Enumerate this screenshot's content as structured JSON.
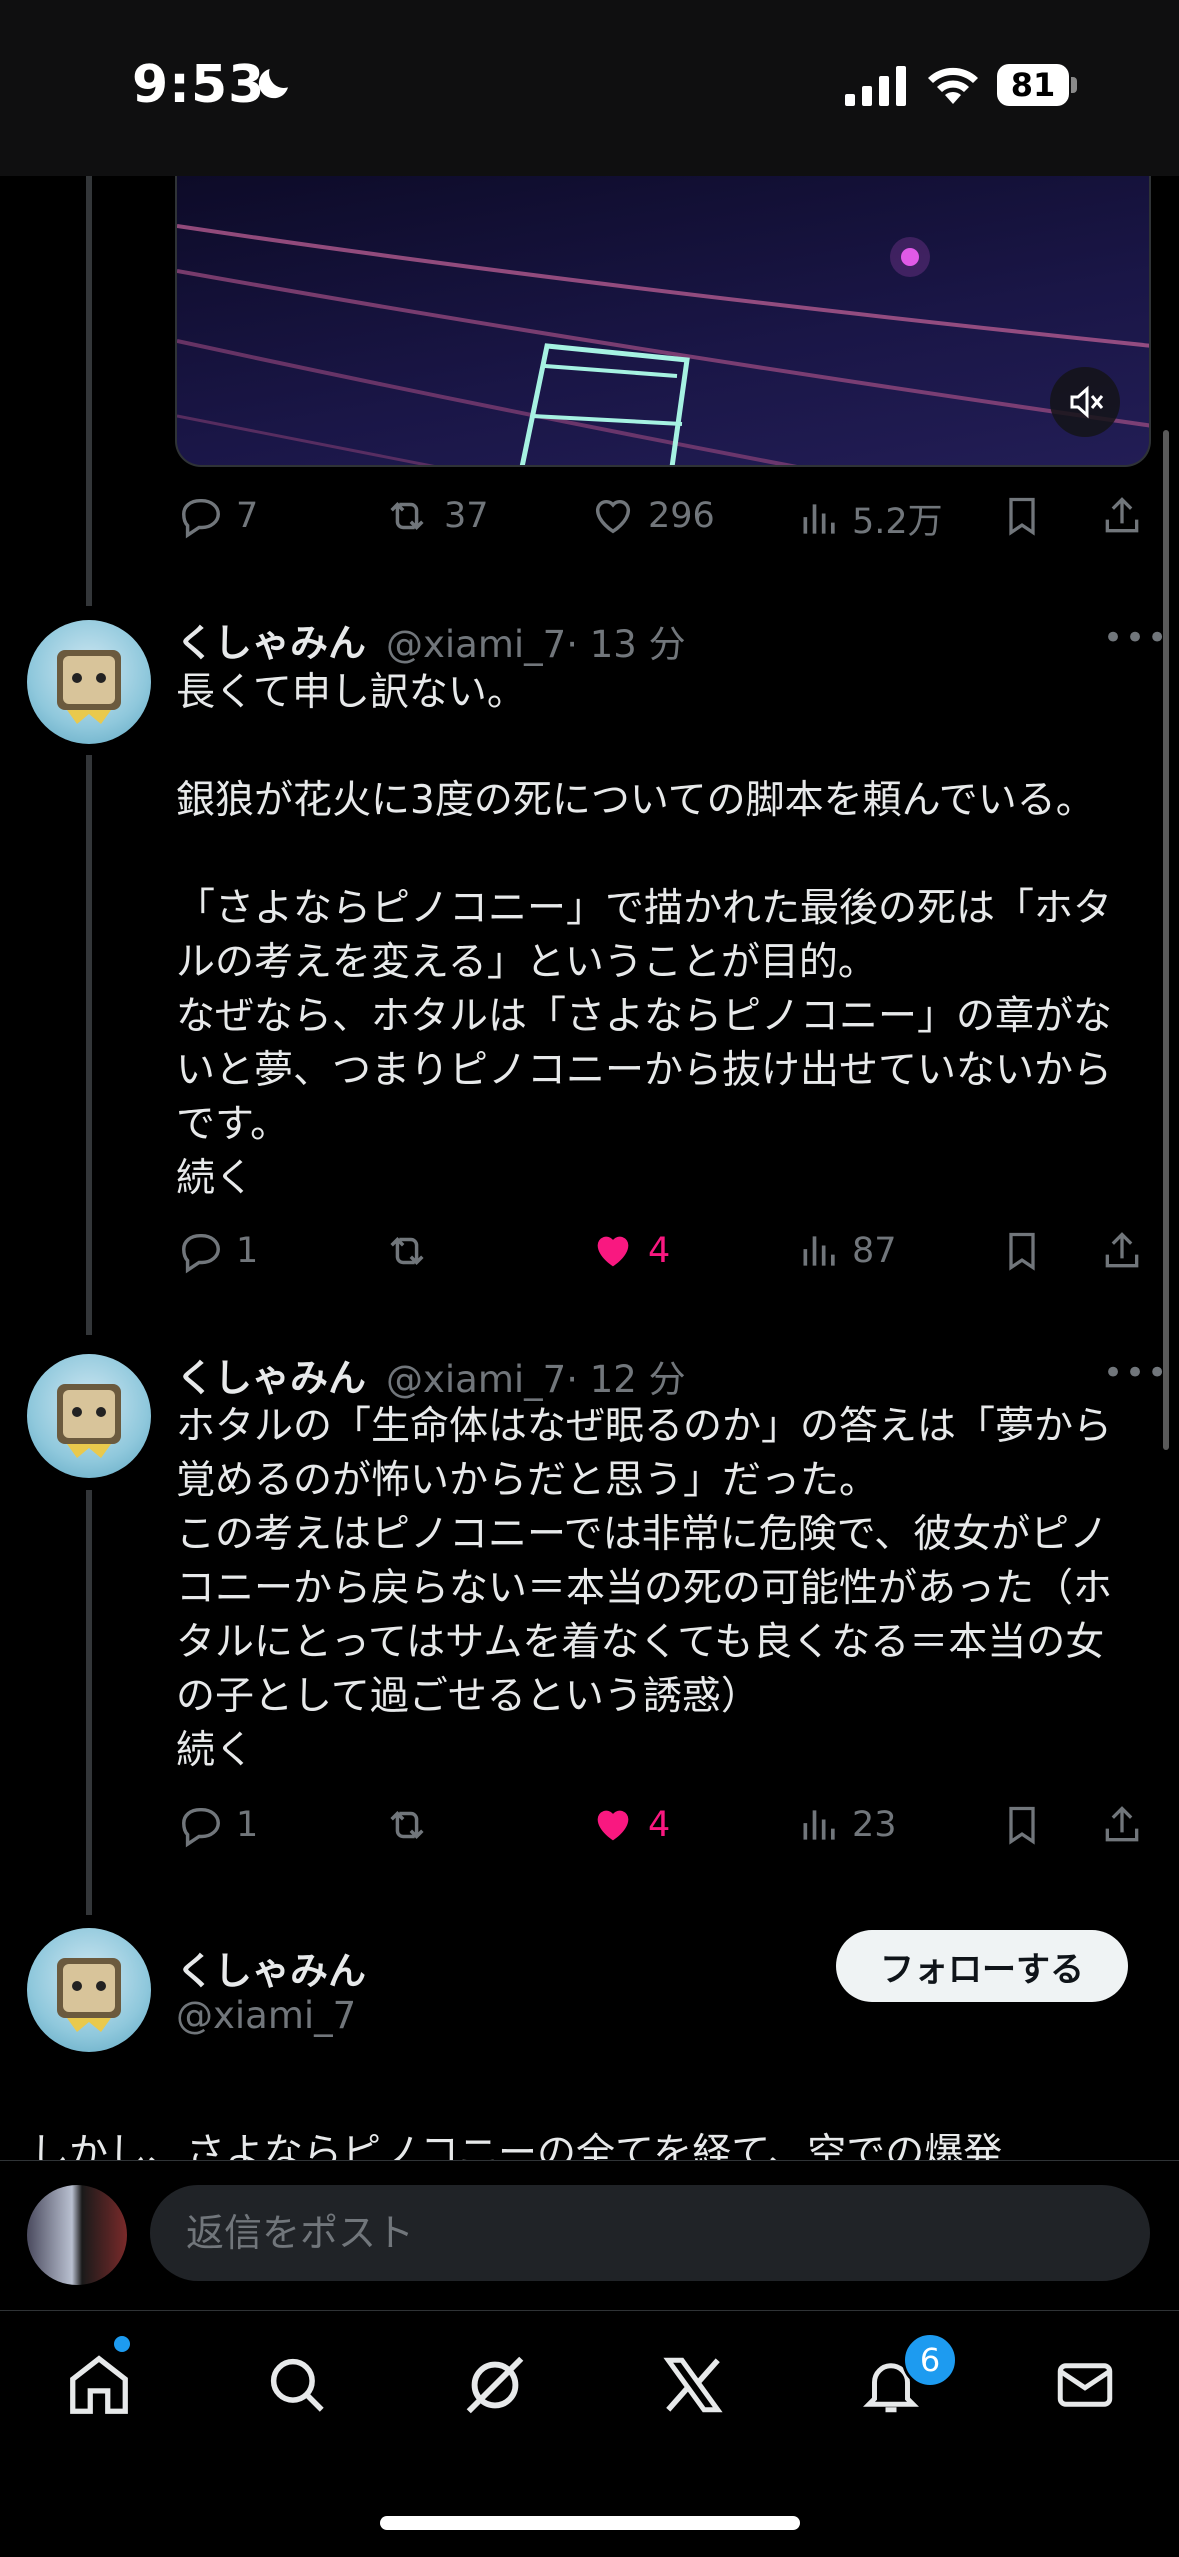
{
  "status_bar": {
    "time": "9:53",
    "battery": "81"
  },
  "posts": [
    {
      "actions": {
        "replies": "7",
        "reposts": "37",
        "likes": "296",
        "views": "5.2万"
      }
    },
    {
      "name": "くしゃみん",
      "handle": "@xiami_7",
      "time": "· 13 分",
      "text": "長くて申し訳ない。\n\n銀狼が花火に3度の死についての脚本を頼んでいる。\n\n「さよならピノコニー」で描かれた最後の死は「ホタルの考えを変える」ということが目的。\nなぜなら、ホタルは「さよならピノコニー」の章がないと夢、つまりピノコニーから抜け出せていないからです。\n続く",
      "actions": {
        "replies": "1",
        "reposts": "",
        "likes": "4",
        "views": "87"
      }
    },
    {
      "name": "くしゃみん",
      "handle": "@xiami_7",
      "time": "· 12 分",
      "text": "ホタルの「生命体はなぜ眠るのか」の答えは「夢から覚めるのが怖いからだと思う」だった。\nこの考えはピノコニーでは非常に危険で、彼女がピノコニーから戻らない＝本当の死の可能性があった（ホタルにとってはサムを着なくても良くなる＝本当の女の子として過ごせるという誘惑）\n続く",
      "actions": {
        "replies": "1",
        "reposts": "",
        "likes": "4",
        "views": "23"
      }
    },
    {
      "name": "くしゃみん",
      "handle": "@xiami_7",
      "follow_label": "フォローする",
      "text": "しかし、さよならピノコニーの全てを経て、空での爆発"
    }
  ],
  "reply_bar": {
    "placeholder": "返信をポスト"
  },
  "nav": {
    "notifications_badge": "6"
  },
  "colors": {
    "like": "#f91880",
    "accent": "#1d9bf0",
    "muted": "#71767b"
  }
}
